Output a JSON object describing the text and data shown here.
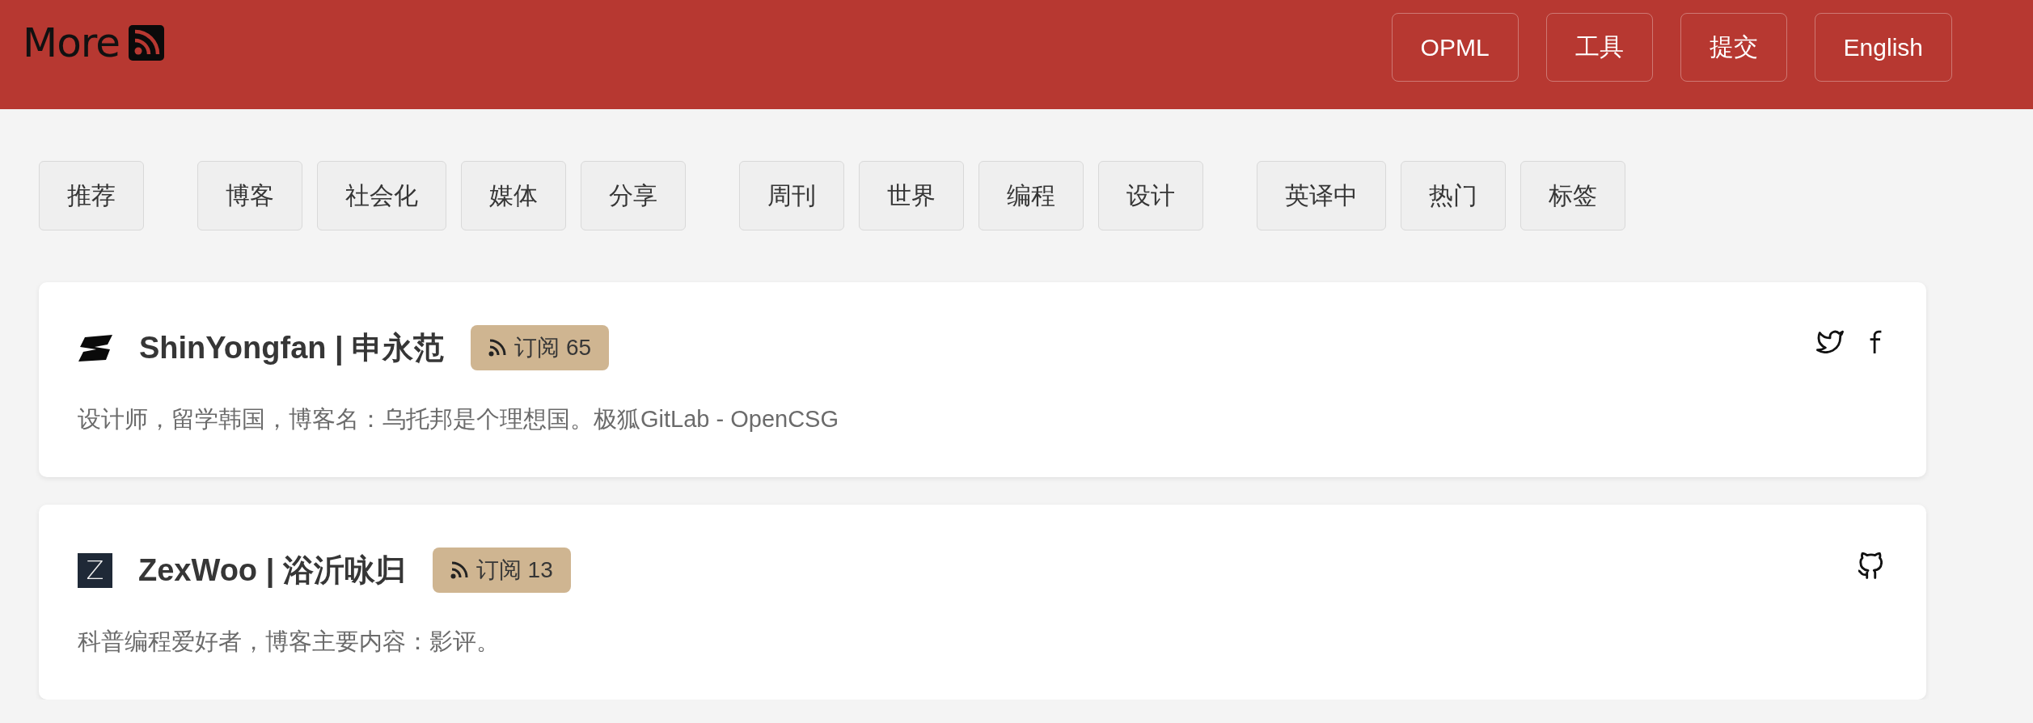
{
  "header": {
    "logo": "More",
    "buttons": [
      "OPML",
      "工具",
      "提交",
      "English"
    ]
  },
  "tab_groups": [
    {
      "tabs": [
        {
          "label": "推荐",
          "selected": false
        }
      ]
    },
    {
      "tabs": [
        {
          "label": "博客",
          "selected": false
        },
        {
          "label": "社会化",
          "selected": false
        },
        {
          "label": "媒体",
          "selected": false
        },
        {
          "label": "分享",
          "selected": false
        }
      ]
    },
    {
      "tabs": [
        {
          "label": "周刊",
          "selected": false
        },
        {
          "label": "世界",
          "selected": false
        },
        {
          "label": "编程",
          "selected": false
        },
        {
          "label": "设计",
          "selected": false
        }
      ]
    },
    {
      "tabs": [
        {
          "label": "英译中",
          "selected": false
        },
        {
          "label": "热门",
          "selected": false
        },
        {
          "label": "标签",
          "selected": false
        }
      ]
    }
  ],
  "cards": [
    {
      "avatar": {
        "kind": "shape"
      },
      "title": "ShinYongfan | 申永范",
      "subscribe": "订阅 65",
      "description": "设计师，留学韩国，博客名：乌托邦是个理想国。极狐GitLab - OpenCSG",
      "links": [
        {
          "kind": "twitter"
        },
        {
          "kind": "facebook"
        }
      ]
    },
    {
      "avatar": {
        "kind": "letter",
        "letter": "Z"
      },
      "title": "ZexWoo | 浴沂咏归",
      "subscribe": "订阅 13",
      "description": "科普编程爱好者，博客主要内容：影评。",
      "links": [
        {
          "kind": "github"
        }
      ]
    }
  ]
}
